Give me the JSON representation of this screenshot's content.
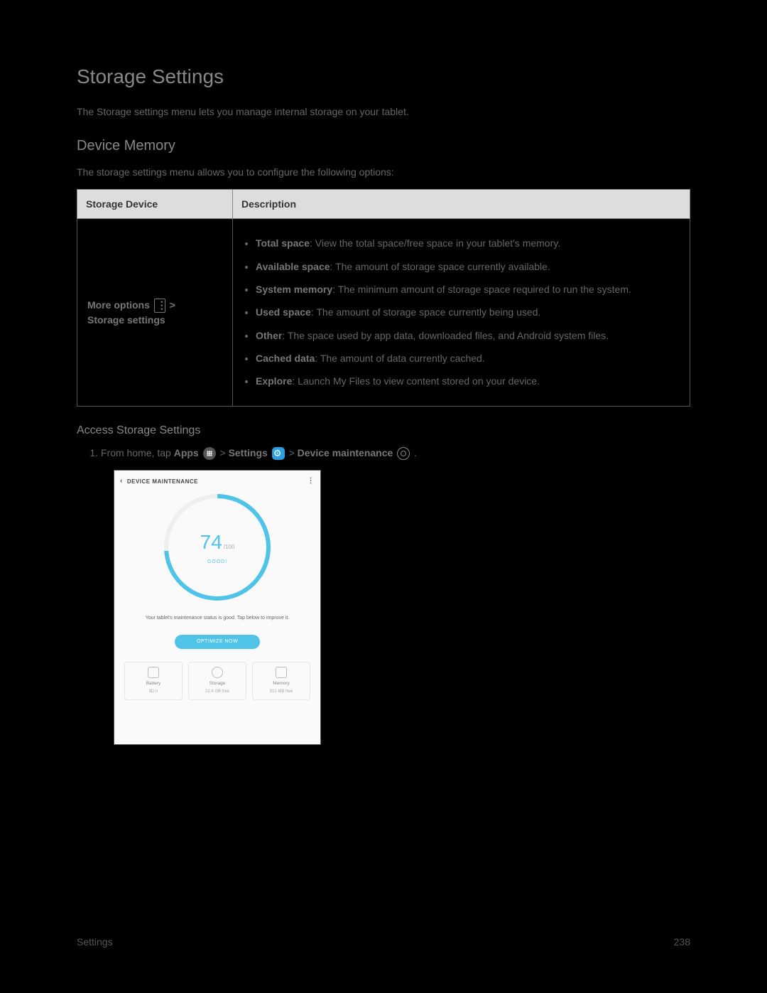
{
  "title": "Storage Settings",
  "intro": "The Storage settings menu lets you manage internal storage on your tablet.",
  "section_overview": "Device Memory",
  "overview_intro": "The storage settings menu allows you to configure the following options:",
  "table": {
    "headers": [
      "Storage Device",
      "Description"
    ],
    "first_col": [
      "More options",
      " > ",
      "Storage settings"
    ],
    "items": [
      {
        "b": "Total space",
        "t": ": View the total space/free space in your tablet's memory."
      },
      {
        "b": "Available space",
        "t": ": The amount of storage space currently available."
      },
      {
        "b": "System memory",
        "t": ": The minimum amount of storage space required to run the system."
      },
      {
        "b": "Used space",
        "t": ": The amount of storage space currently being used."
      },
      {
        "b": "Other",
        "t": ": The space used by app data, downloaded files, and Android system files."
      },
      {
        "b": "Cached data",
        "t": ": The amount of data currently cached."
      },
      {
        "b": "Explore",
        "t": ": Launch My Files to view content stored on your device."
      }
    ]
  },
  "section_access": "Access Storage Settings",
  "step": {
    "prefix": "From home, tap ",
    "apps": "Apps",
    "gt1": " > ",
    "settings": "Settings",
    "gt2": " > ",
    "devmaint": "Device maintenance",
    "period": "."
  },
  "shot": {
    "title": "DEVICE MAINTENANCE",
    "score": "74",
    "score_max": "/100",
    "good": "GOOD!",
    "status": "Your tablet's maintenance status is good. Tap below to improve it.",
    "btn": "OPTIMIZE NOW",
    "cards": [
      {
        "name": "Battery",
        "sub": "9D h"
      },
      {
        "name": "Storage",
        "sub": "22.4 GB free"
      },
      {
        "name": "Memory",
        "sub": "921 MB free"
      }
    ]
  },
  "footer_left": "Settings",
  "footer_right": "238"
}
